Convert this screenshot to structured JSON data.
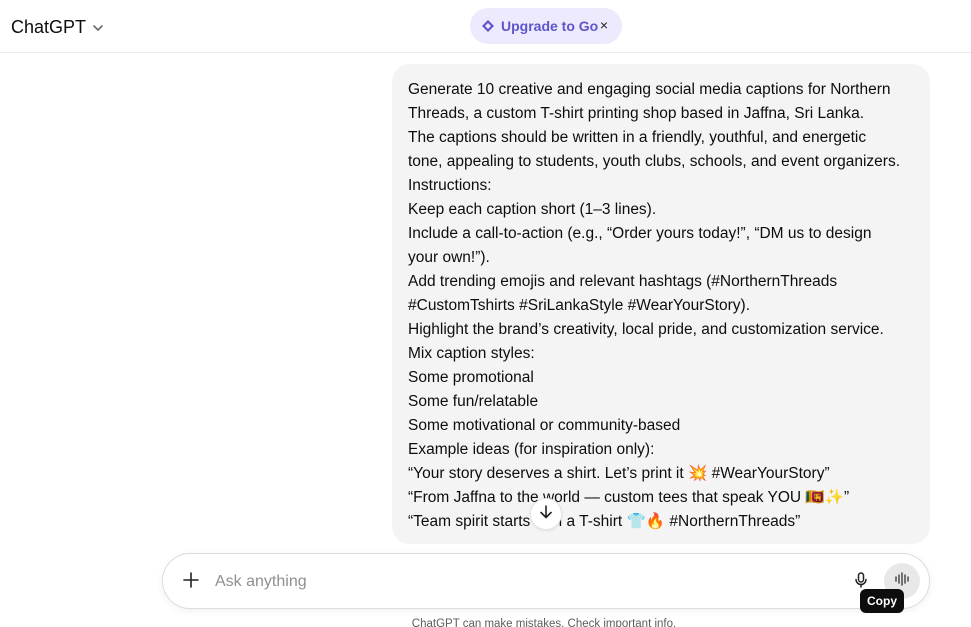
{
  "header": {
    "model_name": "ChatGPT",
    "upgrade_label": "Upgrade to Go",
    "upgrade_close": "×"
  },
  "message": {
    "lines": [
      "Generate 10 creative and engaging social media captions for Northern",
      "Threads, a custom T-shirt printing shop based in Jaffna, Sri Lanka.",
      "The captions should be written in a friendly, youthful, and energetic",
      "tone, appealing to students, youth clubs, schools, and event organizers.",
      "Instructions:",
      "Keep each caption short (1–3 lines).",
      "Include a call-to-action (e.g., “Order yours today!”, “DM us to design",
      "your own!”).",
      "Add trending emojis and relevant hashtags (#NorthernThreads",
      "#CustomTshirts #SriLankaStyle #WearYourStory).",
      "Highlight the brand’s creativity, local pride, and customization service.",
      "Mix caption styles:",
      "Some promotional",
      "Some fun/relatable",
      "Some motivational or community-based",
      "Example ideas (for inspiration only):",
      "“Your story deserves a shirt. Let’s print it 💥 #WearYourStory”",
      "“From Jaffna to the world — custom tees that speak YOU 🇱🇰✨”",
      "“Team spirit starts with a T-shirt 👕🔥 #NorthernThreads”"
    ]
  },
  "composer": {
    "placeholder": "Ask anything"
  },
  "tooltip": {
    "label": "Copy"
  },
  "footer": {
    "disclaimer": "ChatGPT can make mistakes. Check important info."
  },
  "icons": {
    "chevron": "chevron-down-icon",
    "upgrade": "diamond-icon",
    "plus": "plus-icon",
    "mic": "microphone-icon",
    "voice": "voice-waveform-icon",
    "scroll": "arrow-down-icon"
  },
  "colors": {
    "accent": "#5e55c8",
    "pill_bg": "#eceafc",
    "bubble_bg": "#f4f4f4"
  }
}
